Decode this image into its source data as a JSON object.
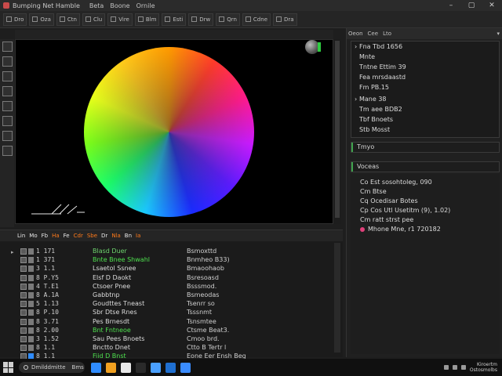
{
  "window": {
    "title": "Bumping Net Hamble",
    "menu": [
      "Beta",
      "Boone",
      "Ornile"
    ],
    "controls": [
      "–",
      "▢",
      "✕"
    ]
  },
  "toolbar": {
    "buttons": [
      "Dro",
      "Oza",
      "Ctn",
      "Clu",
      "Vire",
      "Blm",
      "Esti",
      "Drw",
      "Qrn",
      "Cdne",
      "Dra"
    ]
  },
  "right_panel": {
    "tabs": [
      "Oeon",
      "Cee",
      "Lto"
    ],
    "info_lines": [
      "Fna  Tbd  1656",
      "Mnte",
      "Tntne  Ettim  39",
      "Fea  mrsdaastd",
      "Fm  PB.15",
      "Mane  38",
      "Tm  aee  BDB2",
      "Tbf  Bnoets",
      "Stb  Mosst"
    ],
    "section_1": "Tmyo",
    "section_2": "Voceas",
    "details": [
      "Co  Est  sosohtoleg,  090",
      "Cm  Btse",
      "Cq  Ocedisar  Botes",
      "Cp  Cos  Utl  Usetitm  (9),  1.02)",
      "Cm  ratt  strst  pee"
    ],
    "highlight_line": "Mhone  Mne,  r1 720182"
  },
  "outliner": {
    "headers": [
      {
        "text": "Lin",
        "color": "#e8e8e8"
      },
      {
        "text": "Mo",
        "color": "#e8e8e8"
      },
      {
        "text": "Fb",
        "color": "#e8e8e8"
      },
      {
        "text": "Ha",
        "color": "#ff7a1a"
      },
      {
        "text": "Fe",
        "color": "#e8e8e8"
      },
      {
        "text": "Cdr",
        "color": "#ff7a1a"
      },
      {
        "text": "Sbe",
        "color": "#ff7a1a"
      },
      {
        "text": "Dr",
        "color": "#e8e8e8"
      },
      {
        "text": "Nla",
        "color": "#ff7a1a"
      },
      {
        "text": "Bn",
        "color": "#e8e8e8"
      },
      {
        "text": "Ia",
        "color": "#ff7a1a"
      }
    ],
    "rows": [
      {
        "num": "1  171",
        "name": "Blasd  Duer",
        "name_color": "#6ed46e",
        "type": "Bsmoxttd",
        "swatch": "#7a7a7a"
      },
      {
        "num": "1  371",
        "name": "Bnte  Bnee  Shwahl",
        "name_color": "#4ee04e",
        "type": "Bnmheo  B33)",
        "swatch": "#7a7a7a"
      },
      {
        "num": "3  1.1",
        "name": "Lsaetol  Ssnee",
        "name_color": "#dcdcdc",
        "type": "Bmaoohaob",
        "swatch": "#7a7a7a"
      },
      {
        "num": "8  P.Y5",
        "name": "Elsf  D  Daokt",
        "name_color": "#dcdcdc",
        "type": "Bsresoasd",
        "swatch": "#7a7a7a"
      },
      {
        "num": "4  T.E1",
        "name": "Ctsoer  Pnee",
        "name_color": "#dcdcdc",
        "type": "Bsssmod.",
        "swatch": "#7a7a7a"
      },
      {
        "num": "8  A.1A",
        "name": "Gabbtnp",
        "name_color": "#dcdcdc",
        "type": "Bsmeodas",
        "swatch": "#7a7a7a"
      },
      {
        "num": "5  1.13",
        "name": "Goudttes  Tneast",
        "name_color": "#dcdcdc",
        "type": "Tsenrr  so",
        "swatch": "#7a7a7a"
      },
      {
        "num": "8  P.10",
        "name": "Sbr  Dtse  Rnes",
        "name_color": "#dcdcdc",
        "type": "Tsssnmt",
        "swatch": "#7a7a7a"
      },
      {
        "num": "8  3.71",
        "name": "Pes  Brnesdt",
        "name_color": "#dcdcdc",
        "type": "Tsnsmtee",
        "swatch": "#7a7a7a"
      },
      {
        "num": "8  2.00",
        "name": "Bnt  Fntneoe",
        "name_color": "#4ee04e",
        "type": "Ctsme  Beat3.",
        "swatch": "#7a7a7a"
      },
      {
        "num": "3  1.52",
        "name": "Sau  Pees  Bnoets",
        "name_color": "#dcdcdc",
        "type": "Cmoo  brd.",
        "swatch": "#7a7a7a"
      },
      {
        "num": "8  1.1",
        "name": "Bnctto  Dnet",
        "name_color": "#dcdcdc",
        "type": "Ctto  B  Tertr  l",
        "swatch": "#7a7a7a"
      },
      {
        "num": "8  1.1",
        "name": "Fiid  D  Bnst",
        "name_color": "#4ee04e",
        "type": "Eone  Eer  Ensh  Beg",
        "swatch": "#2f8cff"
      }
    ]
  },
  "taskbar": {
    "search_label": "Dmilddmitte",
    "search_tail": "Bms",
    "apps": [
      {
        "icon": "folder-app-icon",
        "color": "#2f8cff"
      },
      {
        "icon": "orange-app-icon",
        "color": "#f0a020"
      },
      {
        "icon": "document-app-icon",
        "color": "#e8e8e8"
      },
      {
        "icon": "circle-app-icon",
        "color": "#2a2a2a"
      },
      {
        "icon": "chrome-app-icon",
        "color": "#4aa0ff"
      },
      {
        "icon": "blue-app-icon",
        "color": "#1f6fd0"
      },
      {
        "icon": "cube-app-icon",
        "color": "#3a8cff"
      }
    ],
    "clock_time": "Kiroertm",
    "clock_date": "Ostosmolbs"
  },
  "colors": {
    "accent_green": "#3fa34d",
    "accent_orange": "#ff7a1a",
    "accent_pink": "#e0407a"
  }
}
